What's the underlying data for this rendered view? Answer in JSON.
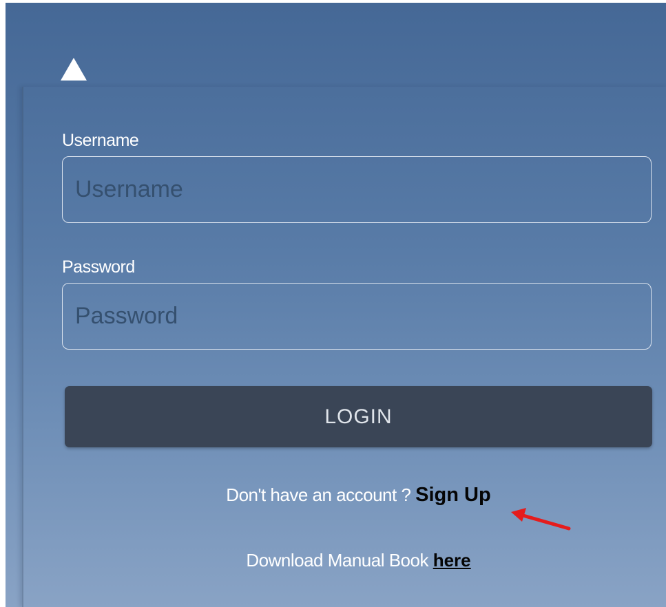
{
  "logo": {
    "icon": "triangle-up-icon",
    "color": "#ffffff"
  },
  "form": {
    "username": {
      "label": "Username",
      "placeholder": "Username",
      "value": ""
    },
    "password": {
      "label": "Password",
      "placeholder": "Password",
      "value": ""
    },
    "login_label": "LOGIN"
  },
  "signup": {
    "prompt": "Don't have an account ?",
    "link_label": "Sign Up"
  },
  "manual": {
    "prompt": "Download Manual Book",
    "link_label": "here"
  },
  "annotation": {
    "icon": "red-arrow-icon",
    "color": "#e51c1c"
  },
  "colors": {
    "panel_top": "#456896",
    "panel_bottom": "#89a3c5",
    "button": "#3a4556",
    "button_text": "#dfe4ea",
    "link": "#050505"
  }
}
